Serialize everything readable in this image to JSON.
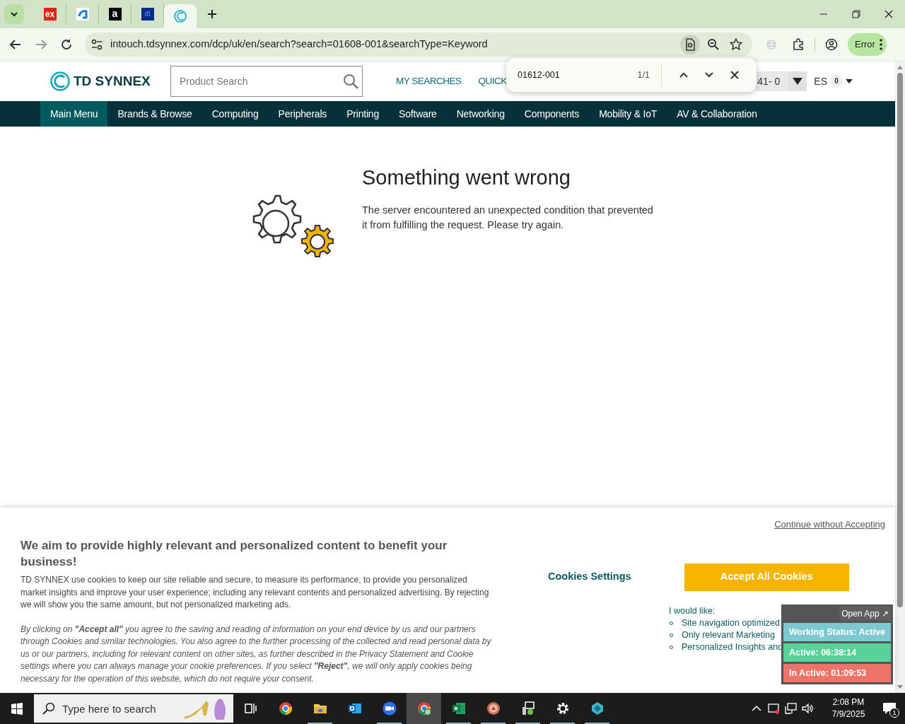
{
  "browser": {
    "tabs": [
      {
        "icon_text": "ex",
        "selected": false
      },
      {
        "selected": false
      },
      {
        "icon_text": "a",
        "selected": false
      },
      {
        "icon_text": "dl",
        "selected": false
      },
      {
        "selected": true
      }
    ],
    "url": "intouch.tdsynnex.com/dcp/uk/en/search?search=01608-001&searchType=Keyword",
    "profile_button": "Error",
    "find_bar": {
      "query": "01612-001",
      "count": "1/1"
    }
  },
  "site_header": {
    "logo": "TD SYNNEX",
    "search": {
      "placeholder": "Product Search"
    },
    "links": [
      "MY SEARCHES",
      "QUICK"
    ],
    "account": "41- 0",
    "language": "ES",
    "cart_count": "0"
  },
  "nav": [
    {
      "label": "Main Menu",
      "selected": true
    },
    {
      "label": "Brands & Browse",
      "selected": false
    },
    {
      "label": "Computing",
      "selected": false
    },
    {
      "label": "Peripherals",
      "selected": false
    },
    {
      "label": "Printing",
      "selected": false
    },
    {
      "label": "Software",
      "selected": false
    },
    {
      "label": "Networking",
      "selected": false
    },
    {
      "label": "Components",
      "selected": false
    },
    {
      "label": "Mobility & IoT",
      "selected": false
    },
    {
      "label": "AV & Collaboration",
      "selected": false
    }
  ],
  "error": {
    "title": "Something went wrong",
    "message": "The server encountered an unexpected condition that prevented it from fulfilling the request. Please try again."
  },
  "cookie_banner": {
    "continue_link": "Continue without Accepting",
    "heading": "We aim to provide highly relevant and personalized content to benefit your business!",
    "body": "TD SYNNEX use cookies to keep our site reliable and secure, to measure its performance, to provide you personalized market insights and improve your user experience; including any relevant contents and personalized advertising. By rejecting we will show you the same amount, but not personalized marketing ads.",
    "consent": "By clicking on  **\"Accept all\"**  you agree to the saving and reading of information on your end device by us and our partners through Cookies and similar technologies. You also agree to the further processing of the collected and read personal data by us or our partners, including for relevant content on other sites, as further described in the Privacy Statement and Cookie settings where you can always manage your cookie preferences. If you select  **\"Reject\"**, we will only apply cookies being necessary for the operation of this website, which do not require your consent.",
    "settings_button": "Cookies Settings",
    "accept_button": "Accept All Cookies",
    "list_title": "I would like:",
    "list": [
      "Site navigation optimized",
      "Only relevant Marketing",
      "Personalized Insights and"
    ]
  },
  "status_widget": {
    "open_app": "Open App ↗",
    "rows": [
      {
        "kind": "status",
        "text": "Working Status: Active"
      },
      {
        "kind": "active",
        "text": "Active: 06:38:14"
      },
      {
        "kind": "inactive",
        "text": "In Active: 01:09:53"
      }
    ]
  },
  "taskbar": {
    "search_placeholder": "Type here to search",
    "apps": [
      {
        "kind": "taskview",
        "running": false,
        "selected": false
      },
      {
        "kind": "chrome",
        "running": false,
        "selected": false
      },
      {
        "kind": "folder",
        "running": true,
        "selected": false
      },
      {
        "kind": "mail",
        "running": false,
        "selected": false
      },
      {
        "kind": "video",
        "running": true,
        "selected": false
      },
      {
        "kind": "chrome-user",
        "running": false,
        "selected": true
      },
      {
        "kind": "sheet",
        "running": true,
        "selected": false
      },
      {
        "kind": "badge",
        "running": true,
        "selected": false
      },
      {
        "kind": "monitor",
        "running": true,
        "selected": false
      },
      {
        "kind": "gear",
        "running": true,
        "selected": false
      },
      {
        "kind": "diamond",
        "running": true,
        "selected": false
      }
    ],
    "time": "2:08 PM",
    "date": "7/9/2025",
    "notification_count": "1"
  }
}
